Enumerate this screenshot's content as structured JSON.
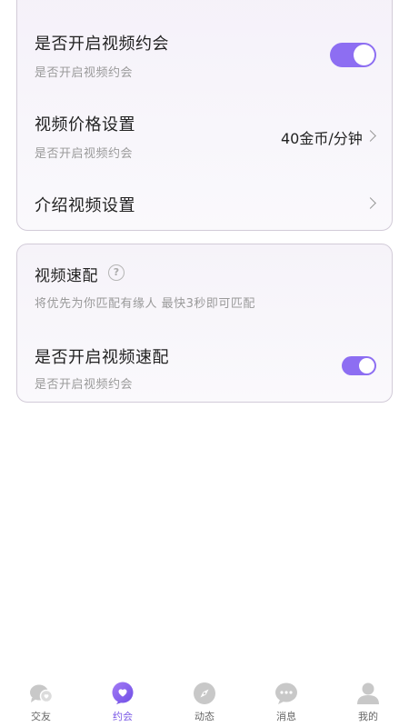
{
  "card1": {
    "rows": [
      {
        "title": "是否开启视频约会",
        "subtitle": "是否开启视频约会",
        "toggle_on": true
      },
      {
        "title": "视频价格设置",
        "subtitle": "是否开启视频约会",
        "value": "40金币/分钟"
      },
      {
        "title": "介绍视频设置"
      }
    ]
  },
  "card2": {
    "title": "视频速配",
    "help_icon": "question-icon",
    "description": "将优先为你匹配有缘人 最快3秒即可匹配",
    "row": {
      "title": "是否开启视频速配",
      "subtitle": "是否开启视频约会",
      "toggle_on": true
    }
  },
  "tabbar": {
    "tabs": [
      {
        "label": "交友",
        "icon": "chat-heart-icon",
        "active": false
      },
      {
        "label": "约会",
        "icon": "heart-bubble-icon",
        "active": true
      },
      {
        "label": "动态",
        "icon": "compass-icon",
        "active": false
      },
      {
        "label": "消息",
        "icon": "message-icon",
        "active": false
      },
      {
        "label": "我的",
        "icon": "profile-icon",
        "active": false
      }
    ]
  },
  "colors": {
    "accent": "#8d6ef2",
    "active_tab": "#7a58e6",
    "inactive_icon": "#c8c8c8"
  }
}
